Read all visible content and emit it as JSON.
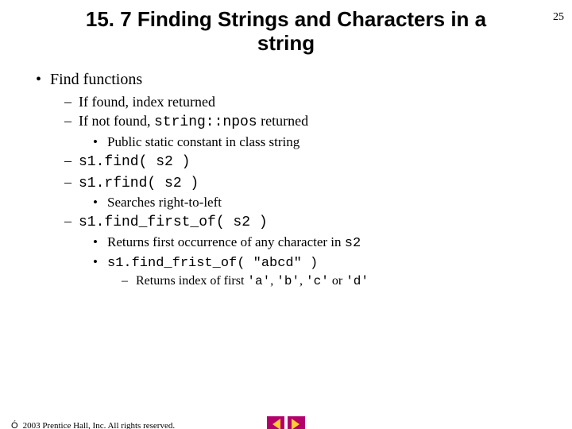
{
  "page_number": "25",
  "title_line1": "15. 7  Finding Strings and Characters in a",
  "title_line2": "string",
  "b1": "Find functions",
  "b1a": "If found, index returned",
  "b1b_pre": "If not found, ",
  "b1b_code": "string::npos",
  "b1b_post": " returned",
  "b1b_i": "Public static constant in class string",
  "b1c_code": "s1.find( s2 )",
  "b1d_code": "s1.rfind( s2 )",
  "b1d_i": "Searches right-to-left",
  "b1e_code": "s1.find_first_of( s2 )",
  "b1e_i_pre": "Returns first occurrence of any character in ",
  "b1e_i_code": "s2",
  "b1e_ii_code": "s1.find_frist_of( \"abcd\" )",
  "b1e_ii_a_pre": "Returns index of first ",
  "b1e_ii_a_c1": "'a'",
  "b1e_ii_a_s1": ", ",
  "b1e_ii_a_c2": "'b'",
  "b1e_ii_a_s2": ", ",
  "b1e_ii_a_c3": "'c'",
  "b1e_ii_a_s3": " or ",
  "b1e_ii_a_c4": "'d'",
  "footer": "2003 Prentice Hall, Inc. All rights reserved."
}
